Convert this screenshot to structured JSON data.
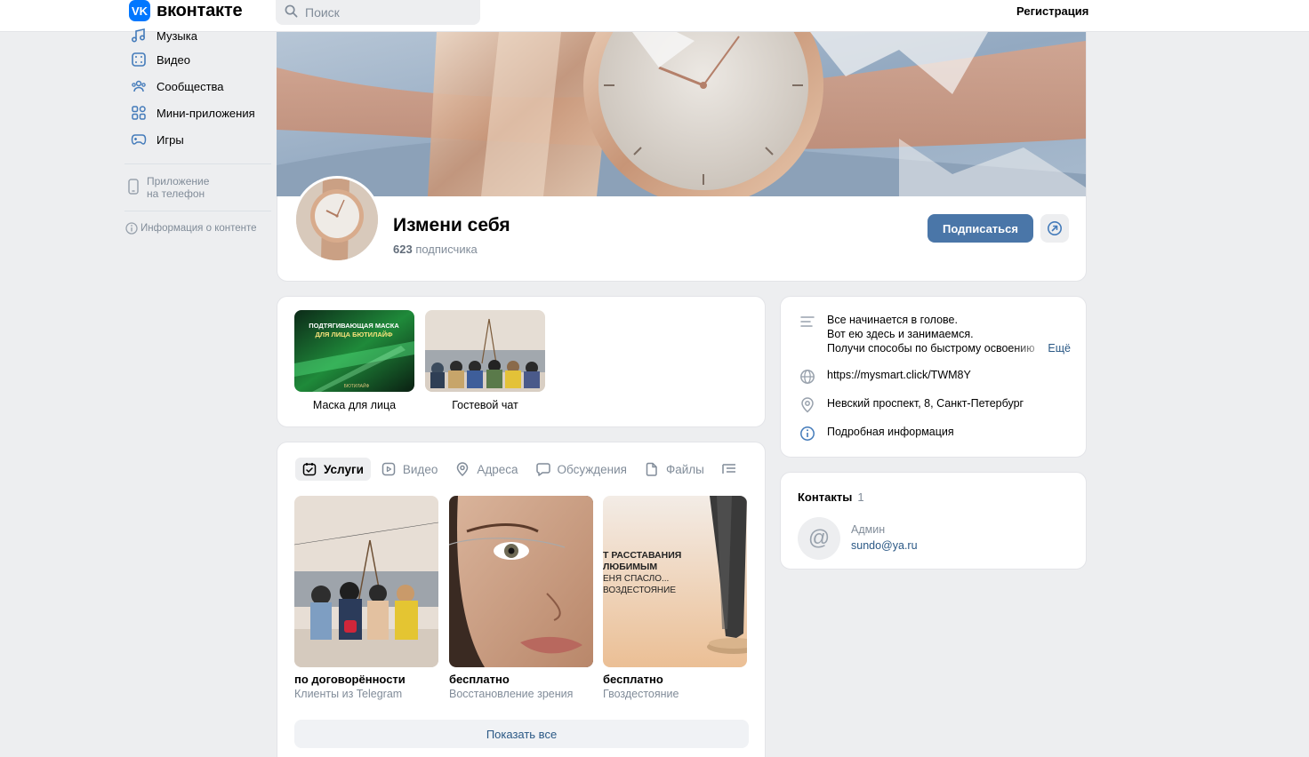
{
  "header": {
    "logo_text": "вконтакте",
    "logo_mark": "VK",
    "search_placeholder": "Поиск",
    "register_label": "Регистрация"
  },
  "sidebar": {
    "items": [
      {
        "label": "Музыка",
        "icon": "music-icon"
      },
      {
        "label": "Видео",
        "icon": "video-icon"
      },
      {
        "label": "Сообщества",
        "icon": "communities-icon"
      },
      {
        "label": "Мини-приложения",
        "icon": "mini-apps-icon"
      },
      {
        "label": "Игры",
        "icon": "games-icon"
      }
    ],
    "phone_app_line1": "Приложение",
    "phone_app_line2": "на телефон",
    "content_info": "Информация о контенте"
  },
  "group": {
    "title": "Измени себя",
    "subscribers_count": "623",
    "subscribers_label": "подписчика",
    "subscribe_button": "Подписаться"
  },
  "apps": [
    {
      "caption": "Маска для лица",
      "thumb_line1": "ПОДТЯГИВАЮЩАЯ МАСКА",
      "thumb_line2": "ДЛЯ ЛИЦА БЮТИЛАЙФ",
      "thumb_brand": "БЮТИЛАЙФ"
    },
    {
      "caption": "Гостевой чат"
    }
  ],
  "tabs": [
    {
      "label": "Услуги",
      "icon": "services-icon",
      "active": true
    },
    {
      "label": "Видео",
      "icon": "video-icon",
      "active": false
    },
    {
      "label": "Адреса",
      "icon": "location-icon",
      "active": false
    },
    {
      "label": "Обсуждения",
      "icon": "discussion-icon",
      "active": false
    },
    {
      "label": "Файлы",
      "icon": "file-icon",
      "active": false
    }
  ],
  "services": [
    {
      "price": "по договорённости",
      "title": "Клиенты из Telegram"
    },
    {
      "price": "бесплатно",
      "title": "Восстановление зрения"
    },
    {
      "price": "бесплатно",
      "title": "Гвоздестояние",
      "thumb_lines": [
        "Т РАССТАВАНИЯ",
        "ЛЮБИМЫМ",
        "ЕНЯ СПАСЛО...",
        "ВОЗДЕСТОЯНИЕ"
      ]
    }
  ],
  "show_all_label": "Показать все",
  "info": {
    "description_line1": "Все начинается в голове.",
    "description_line2": "Вот ею здесь и занимаемся.",
    "description_line3": "Получи способы по быстрому освоению",
    "more_label": "Ещё",
    "website": "https://mysmart.click/TWM8Y",
    "address": "Невский проспект, 8, Санкт-Петербург",
    "details_label": "Подробная информация"
  },
  "contacts": {
    "title": "Контакты",
    "count": "1",
    "role": "Админ",
    "email": "sundo@ya.ru"
  },
  "colors": {
    "accent": "#4a76a8",
    "link": "#2a5885",
    "background": "#edeef0",
    "vk_blue": "#0077ff"
  }
}
